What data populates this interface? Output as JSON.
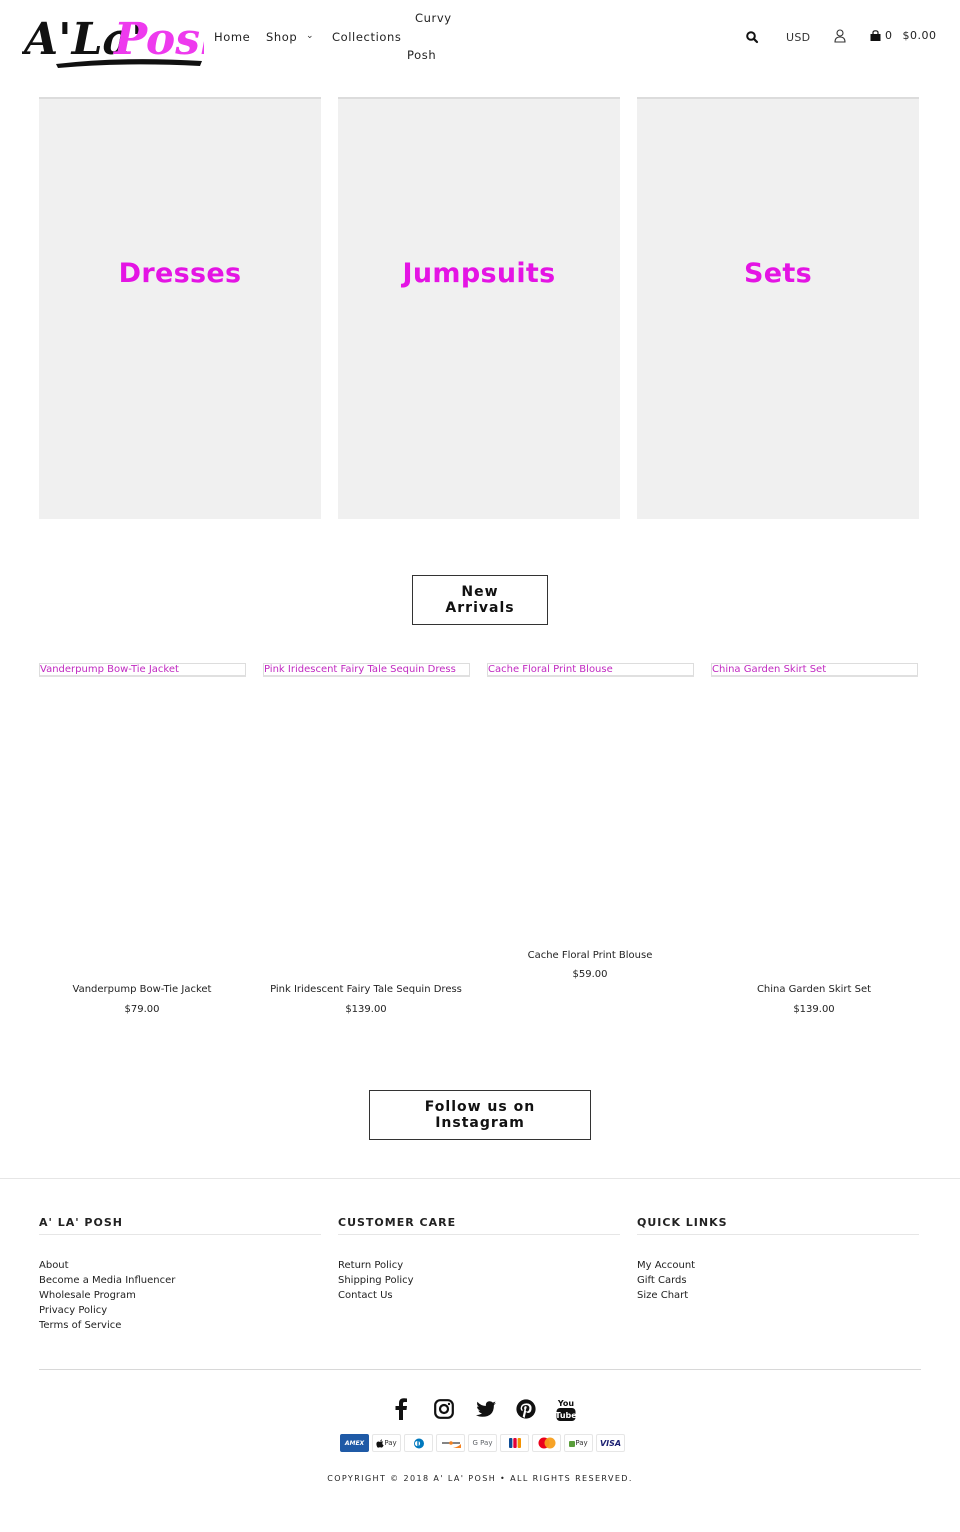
{
  "header": {
    "logo_alt": "A'La'Posh",
    "logo_part1": "A'La'",
    "logo_part2": "Posh",
    "nav": {
      "home": "Home",
      "shop": "Shop",
      "collections": "Collections",
      "curvy_line1": "Curvy",
      "curvy_line2": "Posh"
    },
    "currency": "USD",
    "cart_count": "0",
    "cart_total": "$0.00"
  },
  "categories": [
    {
      "label": "Dresses"
    },
    {
      "label": "Jumpsuits"
    },
    {
      "label": "Sets"
    }
  ],
  "new_arrivals": {
    "button_label": "New Arrivals",
    "products": [
      {
        "image_alt": "Vanderpump Bow-Tie Jacket",
        "title": "Vanderpump Bow-Tie Jacket",
        "price": "$79.00"
      },
      {
        "image_alt": "Pink Iridescent Fairy Tale Sequin Dress",
        "title": "Pink Iridescent Fairy Tale Sequin Dress",
        "price": "$139.00"
      },
      {
        "image_alt": "Cache Floral Print Blouse",
        "title": "Cache Floral Print Blouse",
        "price": "$59.00"
      },
      {
        "image_alt": "China Garden Skirt Set",
        "title": "China Garden Skirt Set",
        "price": "$139.00"
      }
    ]
  },
  "instagram": {
    "button_label": "Follow us on Instagram"
  },
  "footer": {
    "columns": [
      {
        "heading": "A' LA' POSH",
        "links": [
          "About",
          "Become a Media Influencer",
          "Wholesale Program",
          "Privacy Policy",
          "Terms of Service"
        ]
      },
      {
        "heading": "CUSTOMER CARE",
        "links": [
          "Return Policy",
          "Shipping Policy",
          "Contact Us"
        ]
      },
      {
        "heading": "QUICK LINKS",
        "links": [
          "My Account",
          "Gift Cards",
          "Size Chart"
        ]
      }
    ],
    "social": [
      "facebook",
      "instagram",
      "twitter",
      "pinterest",
      "youtube"
    ],
    "youtube_text_top": "You",
    "youtube_text_bottom": "Tube",
    "payments": [
      "AMEX",
      "Pay",
      "",
      "",
      "G Pay",
      "",
      "",
      "Pay",
      "VISA"
    ],
    "copyright": "COPYRIGHT © 2018 A' LA' POSH • ALL RIGHTS RESERVED."
  },
  "colors": {
    "brand_pink": "#e414e4",
    "link_pink": "#c129c1",
    "tile_bg": "#f0f0f0"
  }
}
